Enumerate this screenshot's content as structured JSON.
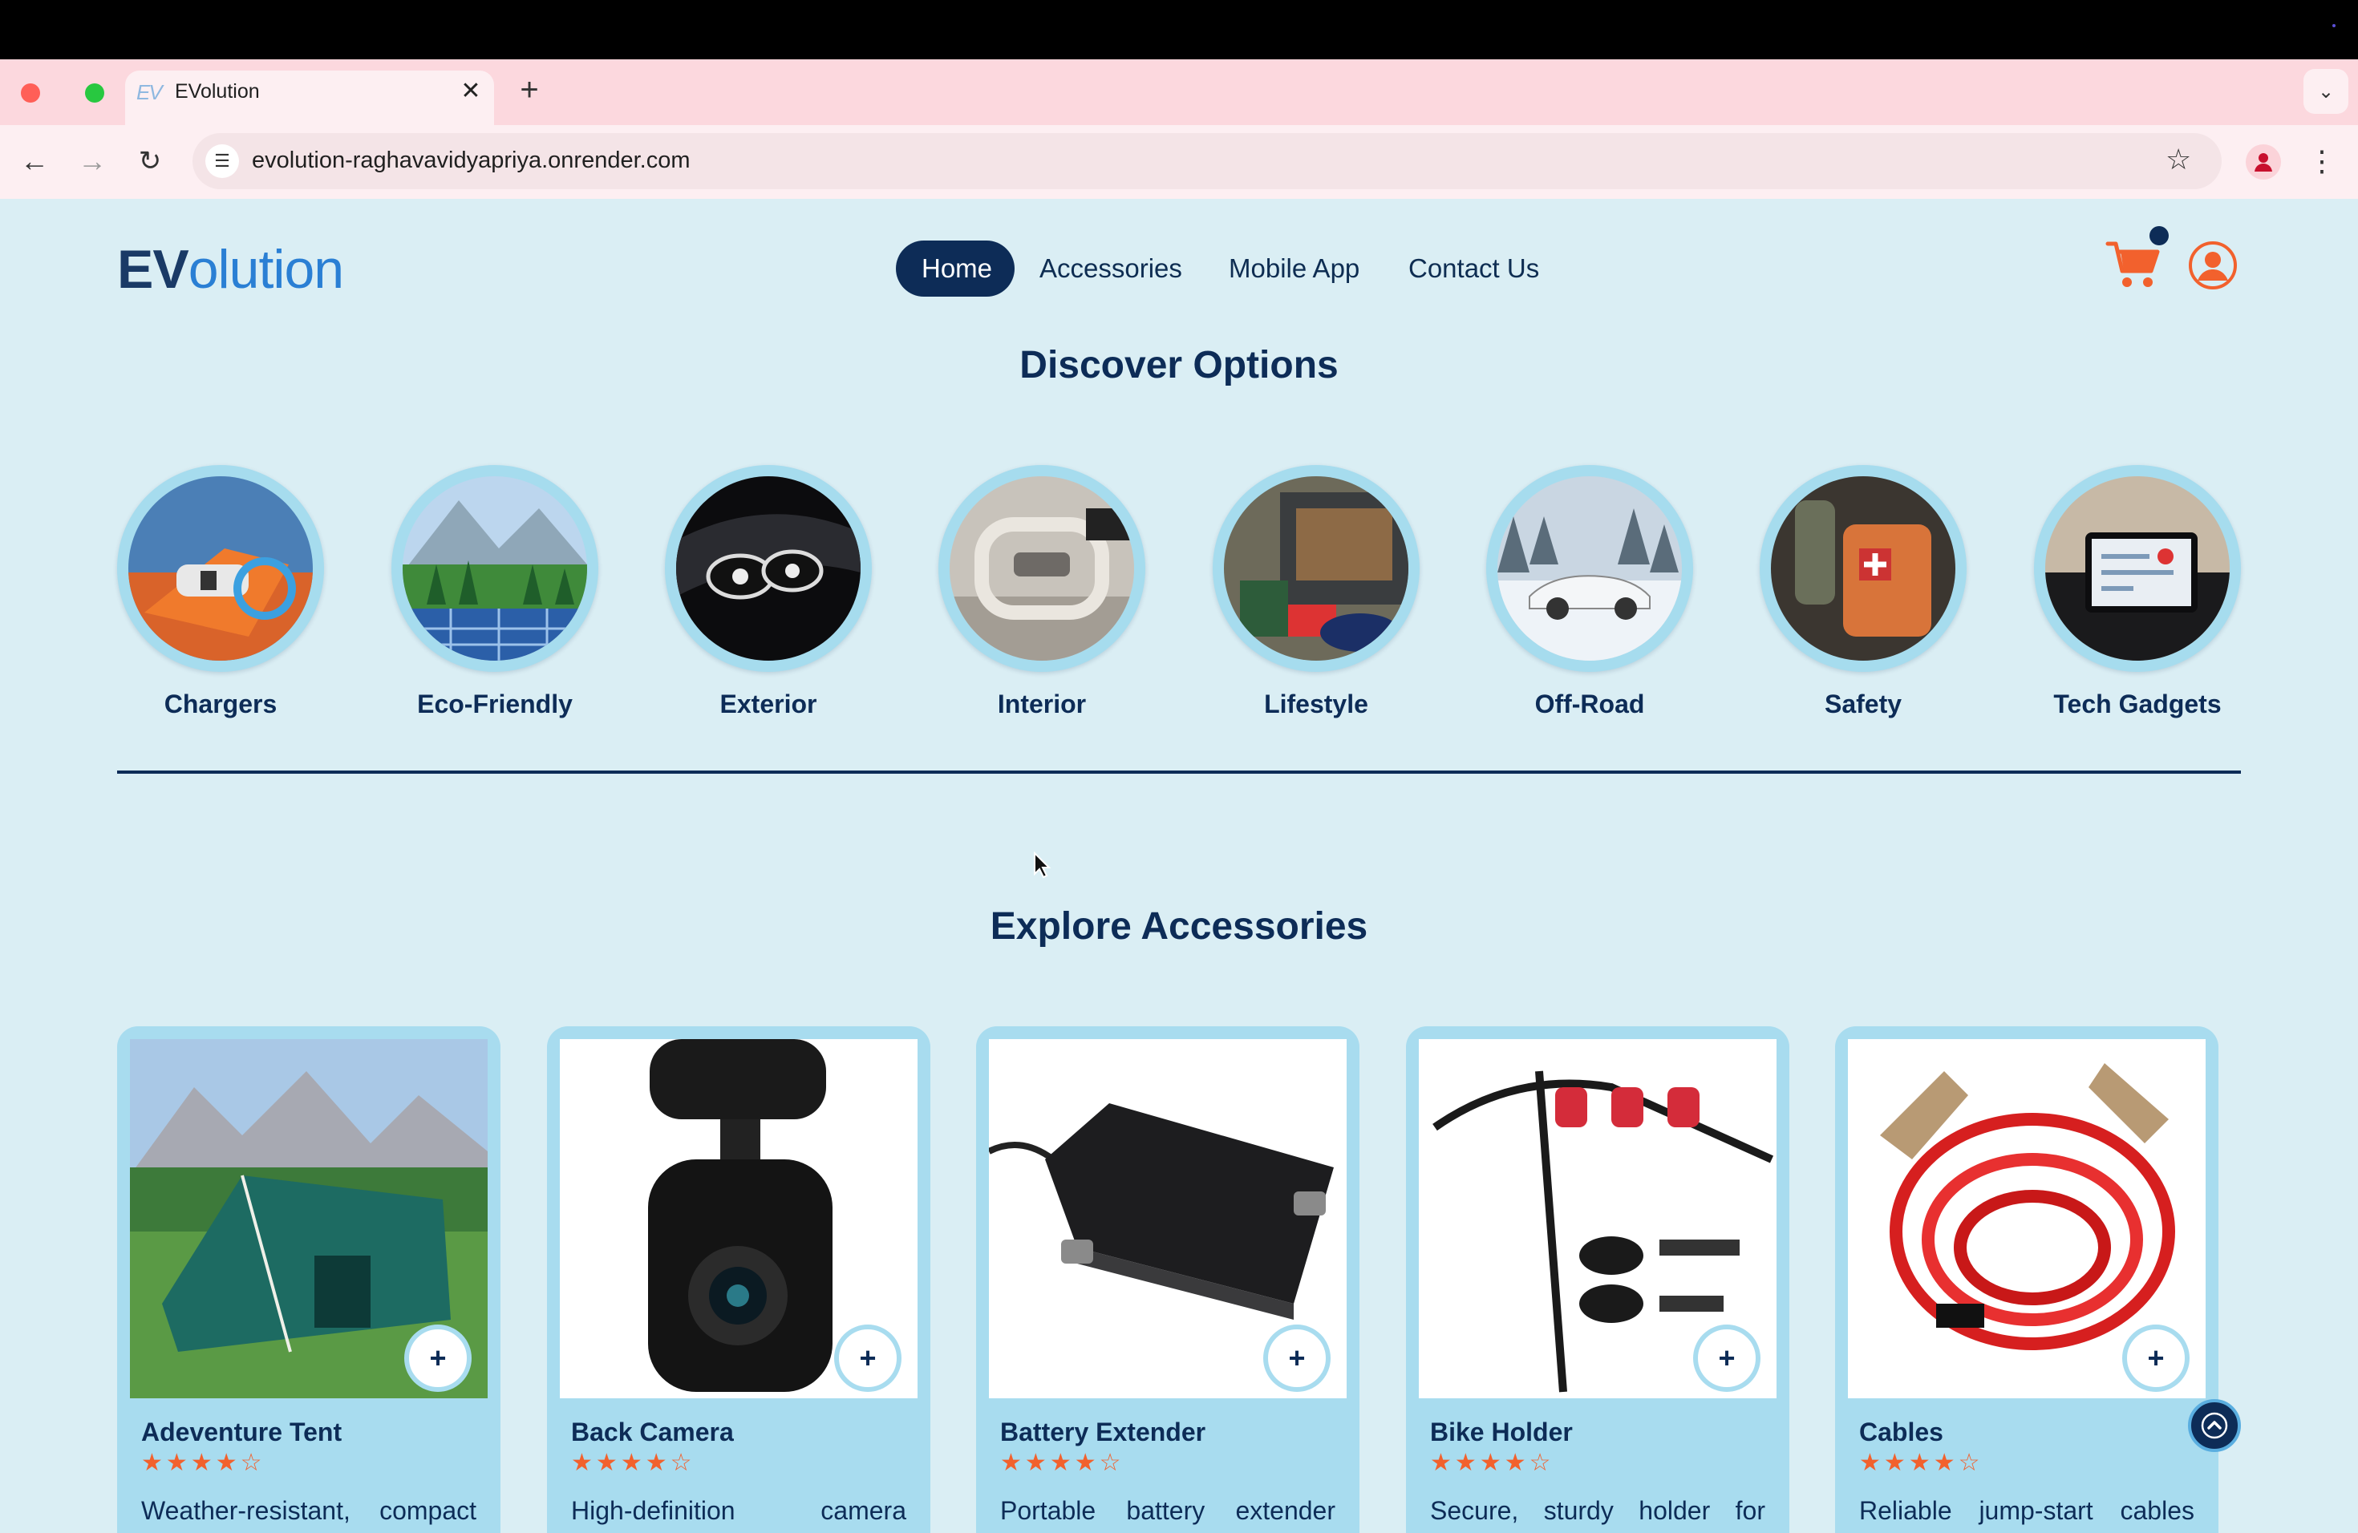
{
  "browser": {
    "tab_title": "EVolution",
    "tab_favicon": "EV",
    "url": "evolution-raghavavidyapriya.onrender.com",
    "icons": [
      "back-arrow-icon",
      "forward-arrow-icon",
      "reload-icon",
      "site-info-icon",
      "bookmark-star-icon",
      "profile-icon",
      "menu-dots-icon",
      "close-icon",
      "plus-icon",
      "chevron-down-icon"
    ]
  },
  "header": {
    "logo_bold": "EV",
    "logo_rest": "olution",
    "nav": [
      {
        "label": "Home",
        "active": true
      },
      {
        "label": "Accessories",
        "active": false
      },
      {
        "label": "Mobile App",
        "active": false
      },
      {
        "label": "Contact Us",
        "active": false
      }
    ],
    "icons": [
      "cart-icon",
      "user-account-icon"
    ],
    "cart_badge_color": "#0d2c57",
    "icon_color": "#f2612d"
  },
  "discover": {
    "title": "Discover Options",
    "categories": [
      {
        "label": "Chargers",
        "image": "ev-charger-plug"
      },
      {
        "label": "Eco-Friendly",
        "image": "forest-solar-panels"
      },
      {
        "label": "Exterior",
        "image": "car-headlight"
      },
      {
        "label": "Interior",
        "image": "steering-wheel"
      },
      {
        "label": "Lifestyle",
        "image": "car-trunk-luggage"
      },
      {
        "label": "Off-Road",
        "image": "car-in-snow"
      },
      {
        "label": "Safety",
        "image": "first-aid-bag"
      },
      {
        "label": "Tech Gadgets",
        "image": "dashboard-screen"
      }
    ]
  },
  "explore": {
    "title": "Explore Accessories",
    "add_label": "+",
    "products": [
      {
        "title": "Adeventure Tent",
        "rating": 4,
        "max_rating": 5,
        "description": "Weather-resistant, compact",
        "image": "camping-tent"
      },
      {
        "title": "Back Camera",
        "rating": 4,
        "max_rating": 5,
        "description": "High-definition camera",
        "image": "dash-camera"
      },
      {
        "title": "Battery Extender",
        "rating": 4,
        "max_rating": 5,
        "description": "Portable battery extender",
        "image": "battery-box"
      },
      {
        "title": "Bike Holder",
        "rating": 4,
        "max_rating": 5,
        "description": "Secure, sturdy holder for",
        "image": "bike-rack"
      },
      {
        "title": "Cables",
        "rating": 4,
        "max_rating": 5,
        "description": "Reliable jump-start cables",
        "image": "jumper-cables"
      }
    ]
  },
  "colors": {
    "page_bg": "#daeef4",
    "navy": "#0d2c57",
    "accent_orange": "#f2612d",
    "card_bg": "#a8dcef"
  }
}
